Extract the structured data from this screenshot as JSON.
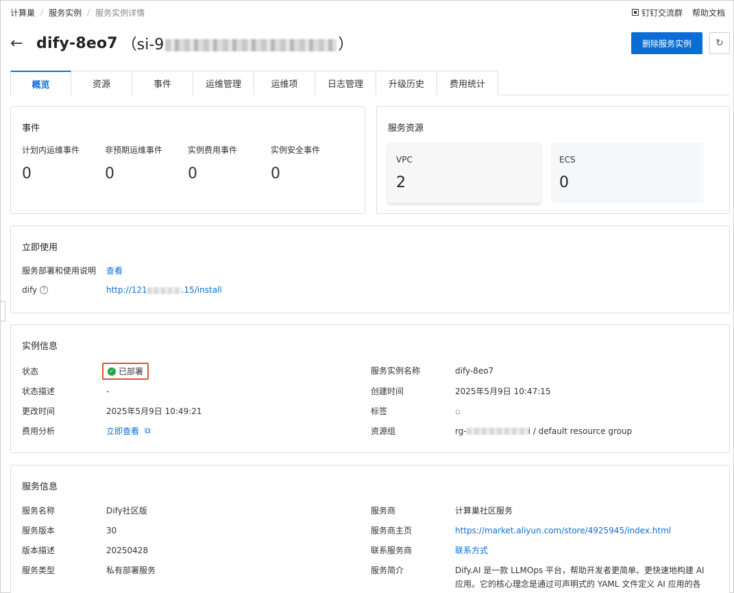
{
  "breadcrumb": {
    "items": [
      "计算巢",
      "服务实例",
      "服务实例详情"
    ]
  },
  "topbar": {
    "dingtalk": "钉钉交流群",
    "help": "帮助文档"
  },
  "header": {
    "title": "dify-8eo7",
    "id_prefix": "（si-9",
    "id_suffix": "）",
    "delete_label": "删除服务实例"
  },
  "tabs": [
    "概览",
    "资源",
    "事件",
    "运维管理",
    "运维项",
    "日志管理",
    "升级历史",
    "费用统计"
  ],
  "events": {
    "title": "事件",
    "stats": [
      {
        "label": "计划内运维事件",
        "value": "0"
      },
      {
        "label": "非预期运维事件",
        "value": "0"
      },
      {
        "label": "实例费用事件",
        "value": "0"
      },
      {
        "label": "实例安全事件",
        "value": "0"
      }
    ]
  },
  "resources": {
    "title": "服务资源",
    "items": [
      {
        "label": "VPC",
        "value": "2"
      },
      {
        "label": "ECS",
        "value": "0"
      }
    ]
  },
  "use_now": {
    "title": "立即使用",
    "doc_label": "服务部署和使用说明",
    "doc_link": "查看",
    "dify_label": "dify",
    "url_prefix": "http://121",
    "url_suffix": ".15/install"
  },
  "instance_info": {
    "title": "实例信息",
    "status_label": "状态",
    "status_value": "已部署",
    "status_desc_label": "状态描述",
    "status_desc_value": "-",
    "modified_label": "更改时间",
    "modified_value": "2025年5月9日 10:49:21",
    "cost_label": "费用分析",
    "cost_link": "立即查看",
    "name_label": "服务实例名称",
    "name_value": "dify-8eo7",
    "created_label": "创建时间",
    "created_value": "2025年5月9日 10:47:15",
    "tag_label": "标签",
    "rg_label": "资源组",
    "rg_prefix": "rg-",
    "rg_suffix": "i / default resource group"
  },
  "service_info": {
    "title": "服务信息",
    "name_label": "服务名称",
    "name_value": "Dify社区版",
    "version_label": "服务版本",
    "version_value": "30",
    "version_desc_label": "版本描述",
    "version_desc_value": "20250428",
    "type_label": "服务类型",
    "type_value": "私有部署服务",
    "provider_label": "服务商",
    "provider_value": "计算巢社区服务",
    "homepage_label": "服务商主页",
    "homepage_value": "https://market.aliyun.com/store/4925945/index.html",
    "contact_label": "联系服务商",
    "contact_value": "联系方式",
    "intro_label": "服务简介",
    "intro_value": "Dify.AI 是一款 LLMOps 平台，帮助开发者更简单、更快速地构建 AI 应用。它的核心理念是通过可声明式的 YAML 文件定义 AI 应用的各"
  },
  "colors": {
    "primary": "#0a6dd6",
    "success": "#1aa64a",
    "highlight_border": "#e0512b"
  }
}
